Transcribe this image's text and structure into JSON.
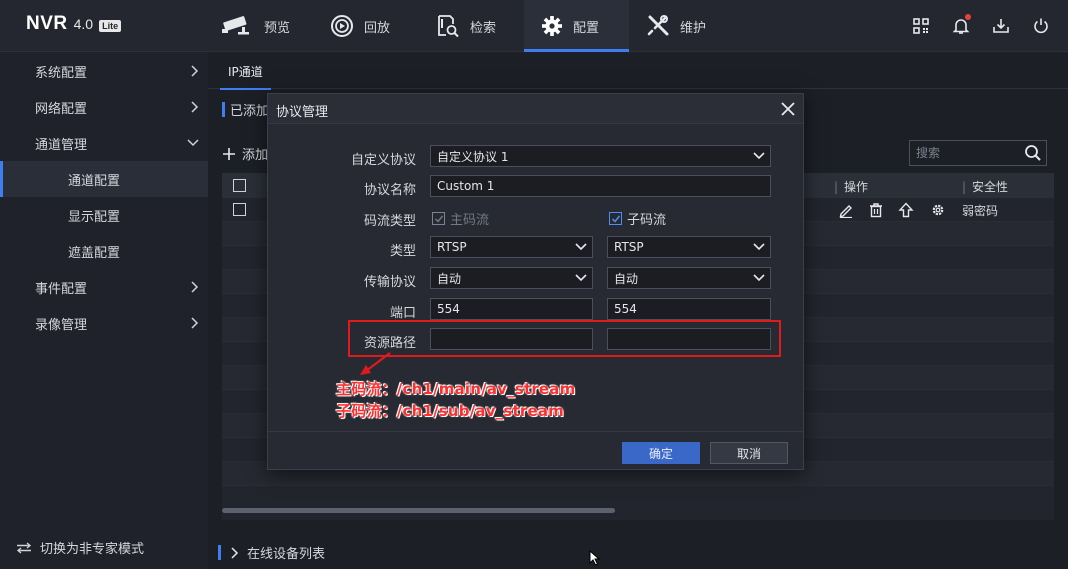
{
  "brand": {
    "name": "NVR",
    "version": "4.0",
    "edition": "Lite"
  },
  "topnav": [
    {
      "label": "预览",
      "icon": "camera-icon"
    },
    {
      "label": "回放",
      "icon": "playback-icon"
    },
    {
      "label": "检索",
      "icon": "search-file-icon"
    },
    {
      "label": "配置",
      "icon": "gear-icon",
      "active": true
    },
    {
      "label": "维护",
      "icon": "tools-icon"
    }
  ],
  "sidebar": {
    "items": [
      {
        "label": "系统配置"
      },
      {
        "label": "网络配置"
      },
      {
        "label": "通道管理",
        "expanded": true
      },
      {
        "label": "通道配置",
        "active": true
      },
      {
        "label": "显示配置"
      },
      {
        "label": "遮盖配置"
      },
      {
        "label": "事件配置"
      },
      {
        "label": "录像管理"
      }
    ],
    "footer": "切换为非专家模式"
  },
  "main": {
    "tab": "IP通道",
    "section_title": "已添加",
    "add_label": "添加",
    "search_placeholder": "搜索",
    "columns": {
      "ops": "操作",
      "security": "安全性"
    },
    "row": {
      "security": "弱密码"
    },
    "footer_link": "在线设备列表"
  },
  "modal": {
    "title": "协议管理",
    "fields": {
      "custom_protocol": {
        "label": "自定义协议",
        "value": "自定义协议 1"
      },
      "protocol_name": {
        "label": "协议名称",
        "value": "Custom 1"
      },
      "stream_type": {
        "label": "码流类型",
        "main": "主码流",
        "sub": "子码流",
        "main_checked": true,
        "main_disabled": true,
        "sub_checked": true
      },
      "type": {
        "label": "类型",
        "main": "RTSP",
        "sub": "RTSP"
      },
      "transport": {
        "label": "传输协议",
        "main": "自动",
        "sub": "自动"
      },
      "port": {
        "label": "端口",
        "main": "554",
        "sub": "554"
      },
      "resource_path": {
        "label": "资源路径",
        "main": "",
        "sub": ""
      }
    },
    "ok": "确定",
    "cancel": "取消"
  },
  "annotation": {
    "main_stream": "主码流：/ch1/main/av_stream",
    "sub_stream": "子码流：/ch1/sub/av_stream"
  },
  "colors": {
    "accent": "#3f7ef0",
    "annotation": "#e01b1b",
    "background": "#1e2129"
  }
}
